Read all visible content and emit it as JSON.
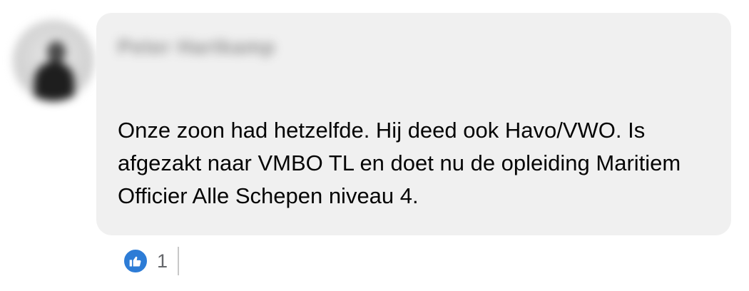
{
  "comment": {
    "author_name": "Peter Hartkamp",
    "text": "Onze zoon had hetzelfde. Hij deed ook Havo/VWO. Is afgezakt naar VMBO TL en doet nu de opleiding Maritiem Officier Alle Schepen niveau 4.",
    "reactions": {
      "icon": "thumbs-up-icon",
      "count": "1",
      "color": "#2d7cd6"
    }
  }
}
